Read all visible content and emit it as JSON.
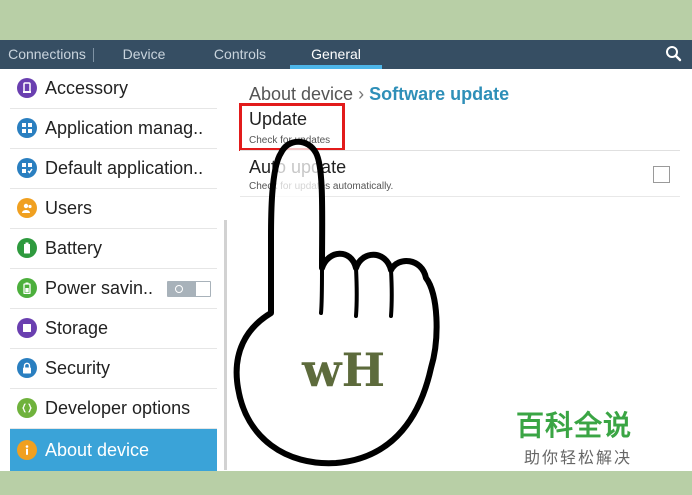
{
  "tabs": [
    {
      "label": "Connections",
      "active": false
    },
    {
      "label": "Device",
      "active": false
    },
    {
      "label": "Controls",
      "active": false
    },
    {
      "label": "General",
      "active": true
    }
  ],
  "colors": {
    "tab_bar": "#364e63",
    "accent": "#4db5e8",
    "selected_item": "#3aa3d8",
    "breadcrumb_current": "#2e8fb8",
    "highlight_box": "#e21b1b",
    "watermark_green": "#3aa544"
  },
  "sidebar": {
    "items": [
      {
        "label": "Accessory",
        "icon": "accessory-icon",
        "color": "#6a3fb0"
      },
      {
        "label": "Application manag..",
        "icon": "application-manager-icon",
        "color": "#2a7fc0"
      },
      {
        "label": "Default application..",
        "icon": "default-applications-icon",
        "color": "#2a7fc0"
      },
      {
        "label": "Users",
        "icon": "users-icon",
        "color": "#f0a020"
      },
      {
        "label": "Battery",
        "icon": "battery-icon",
        "color": "#2e9a3e"
      },
      {
        "label": "Power savin..",
        "icon": "power-saving-icon",
        "color": "#4caf3c",
        "toggle": "off"
      },
      {
        "label": "Storage",
        "icon": "storage-icon",
        "color": "#6a3fb0"
      },
      {
        "label": "Security",
        "icon": "security-icon",
        "color": "#2a7fc0"
      },
      {
        "label": "Developer options",
        "icon": "developer-options-icon",
        "color": "#6fb23c"
      },
      {
        "label": "About device",
        "icon": "about-device-icon",
        "color": "#f0a020",
        "selected": true
      }
    ]
  },
  "breadcrumb": {
    "parent": "About device",
    "separator": "›",
    "current": "Software update"
  },
  "rows": {
    "update": {
      "title": "Update",
      "subtitle": "Check for updates"
    },
    "auto_update": {
      "title": "Auto update",
      "subtitle": "Check for updates automatically.",
      "checked": false
    }
  },
  "overlay": {
    "logo_text": "wH"
  },
  "watermark": {
    "title": "百科全说",
    "subtitle": "助你轻松解决"
  }
}
